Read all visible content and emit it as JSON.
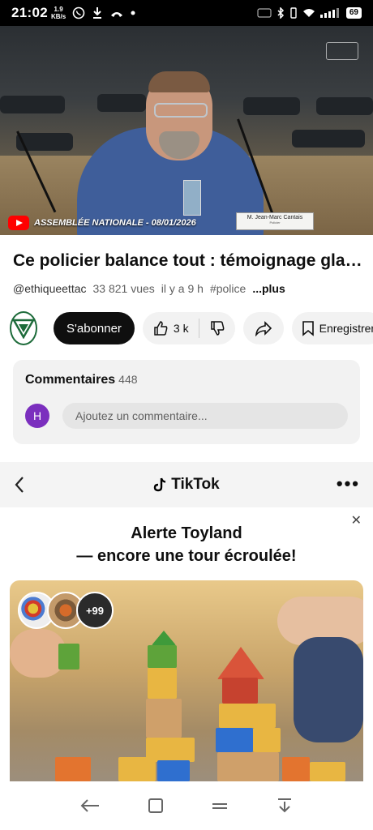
{
  "status_bar": {
    "time": "21:02",
    "speed_value": "1.9",
    "speed_unit": "KB/s",
    "battery": "69"
  },
  "video": {
    "caption": "ASSEMBLÉE NATIONALE - 08/01/2026",
    "nameplate_name": "M. Jean-Marc Cantais",
    "nameplate_role": "Policier"
  },
  "video_info": {
    "title": "Ce policier balance tout : témoignage glaçant",
    "channel_handle": "@ethiqueettac",
    "views": "33 821 vues",
    "age": "il y a 9 h",
    "hashtag": "#police",
    "more_label": "...plus"
  },
  "actions": {
    "subscribe_label": "S'abonner",
    "like_count": "3 k",
    "save_label": "Enregistrer"
  },
  "comments": {
    "heading": "Commentaires",
    "count": "448",
    "user_initial": "H",
    "placeholder": "Ajoutez un commentaire..."
  },
  "ad": {
    "brand": "TikTok",
    "headline_line1": "Alerte Toyland",
    "headline_line2": "— encore une tour écroulée!",
    "participants_more": "+99"
  },
  "icons": {
    "back": "chevron-left-icon",
    "more": "more-icon",
    "close": "close-icon"
  }
}
